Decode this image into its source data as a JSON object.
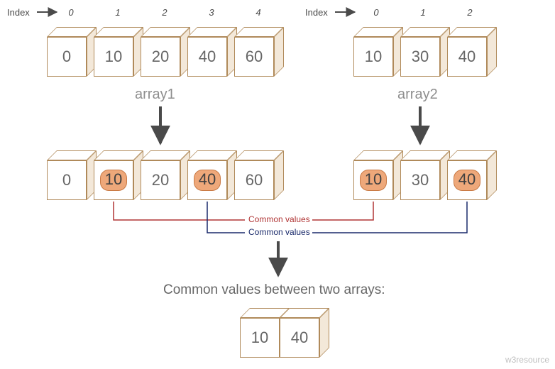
{
  "indexLabel": "Index",
  "labels": {
    "array1": "array1",
    "array2": "array2",
    "commonValuesShort": "Common values",
    "caption1": "Common values between two arrays:"
  },
  "array1": {
    "indices": [
      "0",
      "1",
      "2",
      "3",
      "4"
    ],
    "values": [
      "0",
      "10",
      "20",
      "40",
      "60"
    ]
  },
  "array2": {
    "indices": [
      "0",
      "1",
      "2"
    ],
    "values": [
      "10",
      "30",
      "40"
    ]
  },
  "mid1": {
    "values": [
      "0",
      "10",
      "20",
      "40",
      "60"
    ],
    "highlights": [
      1,
      3
    ]
  },
  "mid2": {
    "values": [
      "10",
      "30",
      "40"
    ],
    "highlights": [
      0,
      2
    ]
  },
  "result": {
    "values": [
      "10",
      "40"
    ]
  },
  "watermark": "w3resource",
  "colors": {
    "red": "#b03535",
    "navy": "#1a2a6b",
    "label": "#666",
    "arrow": "#4a4a4a"
  },
  "chart_data": {
    "type": "table",
    "title": "Common values between two arrays",
    "arrays": {
      "array1": [
        0,
        10,
        20,
        40,
        60
      ],
      "array2": [
        10,
        30,
        40
      ]
    },
    "common_values": [
      10,
      40
    ]
  }
}
